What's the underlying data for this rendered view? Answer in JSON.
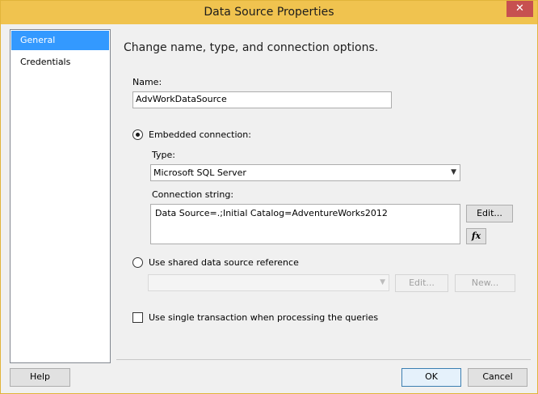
{
  "window": {
    "title": "Data Source Properties",
    "close_glyph": "✕"
  },
  "sidebar": {
    "items": [
      {
        "label": "General"
      },
      {
        "label": "Credentials"
      }
    ]
  },
  "main": {
    "heading": "Change name, type, and connection options.",
    "name_label": "Name:",
    "name_value": "AdvWorkDataSource",
    "embedded": {
      "label": "Embedded connection:",
      "type_label": "Type:",
      "type_value": "Microsoft SQL Server",
      "conn_label": "Connection string:",
      "conn_value": "Data Source=.;Initial Catalog=AdventureWorks2012",
      "edit_label": "Edit...",
      "fx_label": "fx"
    },
    "shared": {
      "label": "Use shared data source reference",
      "select_value": "",
      "edit_label": "Edit...",
      "new_label": "New..."
    },
    "single_tx_label": "Use single transaction when processing the queries"
  },
  "footer": {
    "help_label": "Help",
    "ok_label": "OK",
    "cancel_label": "Cancel"
  }
}
